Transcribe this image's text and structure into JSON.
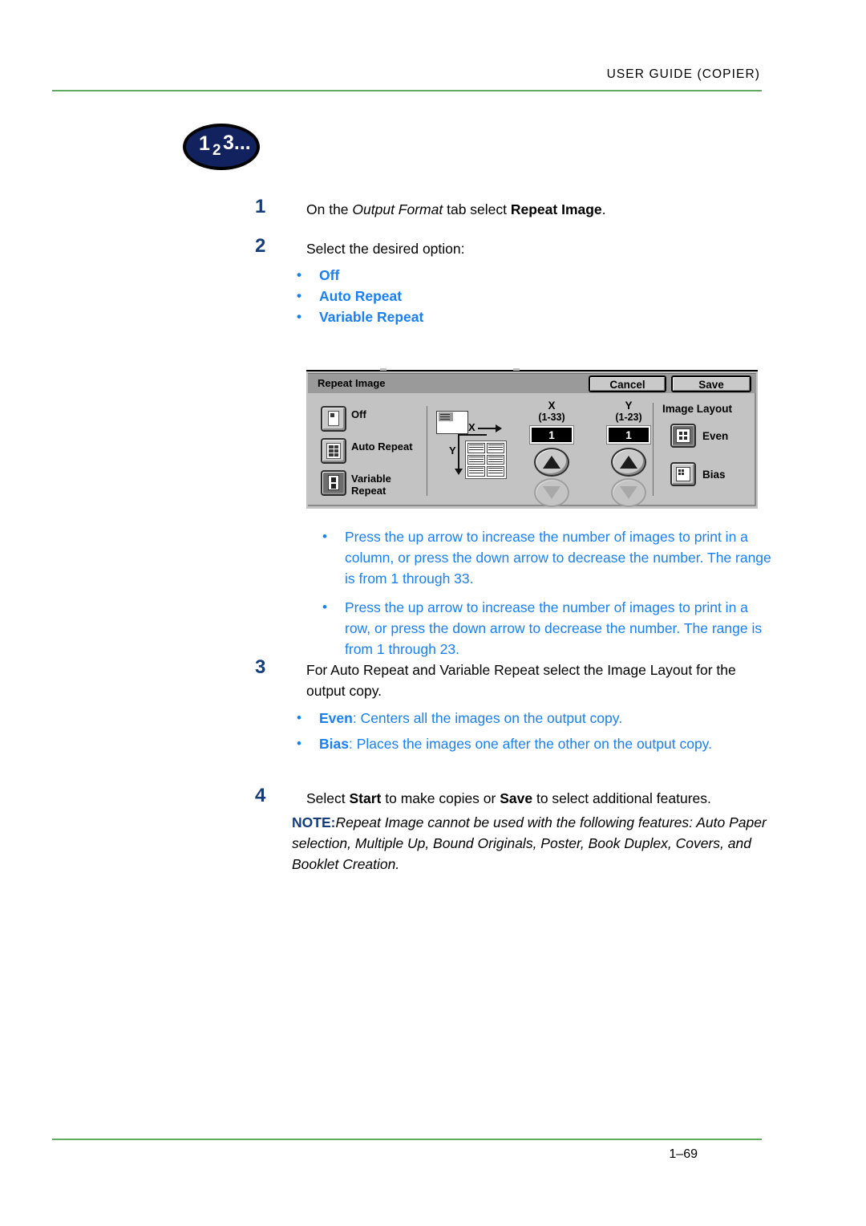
{
  "header": {
    "title": "USER GUIDE (COPIER)"
  },
  "badge": {
    "digit1": "1",
    "digit2": "2",
    "digit3": "3..."
  },
  "steps": [
    {
      "number": "1",
      "text_before": "On the ",
      "italic": "Output Format",
      "text_middle": " tab select ",
      "bold": "Repeat Image",
      "text_after": "."
    },
    {
      "number": "2",
      "text": "Select the desired option:"
    },
    {
      "number": "3",
      "text": "For Auto Repeat and Variable Repeat select the Image Layout for the output copy."
    },
    {
      "number": "4",
      "text_before": "Select ",
      "bold1": "Start",
      "text_middle": " to make copies or ",
      "bold2": "Save",
      "text_after": " to select additional features."
    }
  ],
  "option_bullets": [
    {
      "bullet": "•",
      "label": "Off"
    },
    {
      "bullet": "•",
      "label": "Auto Repeat"
    },
    {
      "bullet": "•",
      "label": "Variable Repeat"
    }
  ],
  "arrow_bullets": [
    {
      "bullet": "•",
      "text": "Press the up arrow to increase the number of images to print in a column, or press the down arrow to decrease the number.  The range is from 1 through 33."
    },
    {
      "bullet": "•",
      "text": "Press the up arrow to increase the number of images to print in a row, or press the down arrow to decrease the number.  The range is from 1 through 23."
    }
  ],
  "layout_bullets": [
    {
      "bullet": "•",
      "term": "Even",
      "desc": ": Centers all the images on the output copy."
    },
    {
      "bullet": "•",
      "term": "Bias",
      "desc": ": Places the images one after the other on the output copy."
    }
  ],
  "note": {
    "label": "NOTE:",
    "text": "Repeat Image cannot be used with the following features: Auto Paper selection, Multiple Up, Bound Originals, Poster, Book Duplex, Covers, and Booklet Creation."
  },
  "footer": {
    "page": "1–69"
  },
  "ui_screenshot": {
    "title": "Repeat Image",
    "cancel_button": "Cancel",
    "save_button": "Save",
    "options": [
      {
        "label": "Off",
        "selected": false
      },
      {
        "label": "Auto Repeat",
        "selected": false
      },
      {
        "label": "Variable Repeat",
        "selected": true
      }
    ],
    "preview": {
      "x_axis_label": "X",
      "y_axis_label": "Y"
    },
    "x_spinner": {
      "label": "X",
      "range": "(1-33)",
      "value": "1",
      "up_enabled": "true",
      "down_enabled": "false"
    },
    "y_spinner": {
      "label": "Y",
      "range": "(1-23)",
      "value": "1",
      "up_enabled": "true",
      "down_enabled": "false"
    },
    "image_layout": {
      "title": "Image Layout",
      "even_label": "Even",
      "bias_label": "Bias"
    }
  },
  "colors": {
    "rule_green": "#5faa5f",
    "step_navy": "#143d7a",
    "bullet_blue": "#1a7ff0",
    "badge_navy": "#12225e"
  }
}
